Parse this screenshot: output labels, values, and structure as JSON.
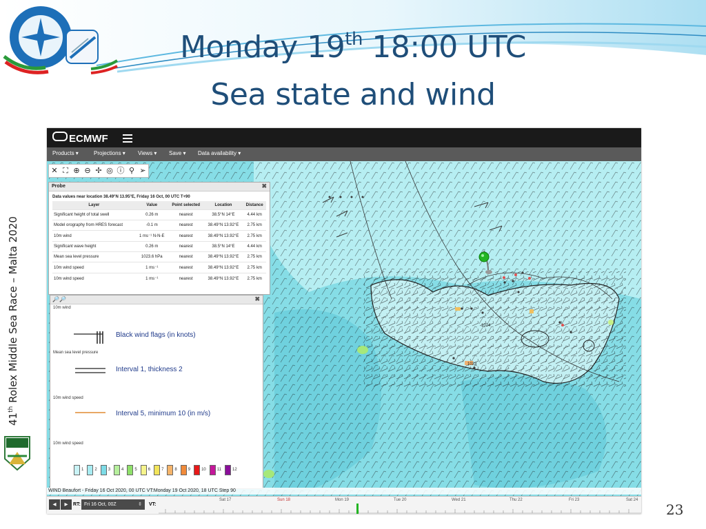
{
  "slide": {
    "title_line1_main": "Monday 19",
    "title_line1_sup": "th",
    "title_line1_tail": " 18:00 UTC",
    "title_line2": "Sea state and wind",
    "side_label_pre": "41",
    "side_label_sup": "th",
    "side_label_post": " Rolex Middle Sea Race – Malta 2020",
    "page_number": "23"
  },
  "app": {
    "brand": "ECMWF",
    "menu": [
      "Products ▾",
      "Projections ▾",
      "Views ▾",
      "Save ▾",
      "Data availability ▾"
    ],
    "toolbar_icons": [
      "close-icon",
      "fullscreen-icon",
      "zoom-in-icon",
      "zoom-out-icon",
      "pan-icon",
      "globe-icon",
      "info-icon",
      "location-pin-icon",
      "share-icon"
    ]
  },
  "probe": {
    "title": "Probe",
    "close": "✖",
    "info": "Data values near location 38.49°N 13.95°E, Friday 16 Oct, 00 UTC T+90",
    "headers": [
      "Layer",
      "Value",
      "Point selected",
      "Location",
      "Distance"
    ],
    "rows": [
      [
        "Significant height of total swell",
        "0.26 m",
        "nearest",
        "38.5°N 14°E",
        "4.44 km"
      ],
      [
        "Model orography from HRES forecast",
        "-0.1 m",
        "nearest",
        "38.49°N 13.92°E",
        "2.75 km"
      ],
      [
        "10m wind",
        "1 ms⁻¹ N-N-E",
        "nearest",
        "38.49°N 13.92°E",
        "2.75 km"
      ],
      [
        "Significant wave height",
        "0.26 m",
        "nearest",
        "38.5°N 14°E",
        "4.44 km"
      ],
      [
        "Mean sea level pressure",
        "1023.6 hPa",
        "nearest",
        "38.49°N 13.92°E",
        "2.75 km"
      ],
      [
        "10m wind speed",
        "1 ms⁻¹",
        "nearest",
        "38.49°N 13.92°E",
        "2.75 km"
      ],
      [
        "10m wind speed",
        "1 ms⁻¹",
        "nearest",
        "38.49°N 13.92°E",
        "2.75 km"
      ]
    ]
  },
  "legend": {
    "zoom_icons": "🔎🔎",
    "close": "✖",
    "sections": [
      {
        "name": "10m wind",
        "desc": "Black wind flags (in knots)"
      },
      {
        "name": "Mean sea level pressure",
        "desc": "Interval 1, thickness 2"
      },
      {
        "name": "10m wind speed",
        "desc": "Interval 5, minimum 10 (in m/s)"
      },
      {
        "name": "10m wind speed",
        "desc": ""
      }
    ],
    "scale_labels": [
      "1",
      "2",
      "3",
      "4",
      "5",
      "6",
      "7",
      "8",
      "9",
      "10",
      "11",
      "12"
    ],
    "scale_colors": [
      "#c9f3f6",
      "#a8ecf2",
      "#7ddbe6",
      "#b6ef9c",
      "#8fe06a",
      "#f6f48c",
      "#f2e45a",
      "#f5b46a",
      "#f08a3a",
      "#e81818",
      "#c4189a",
      "#8a0e9a"
    ]
  },
  "status": {
    "text": "WIND Beaufort - Friday 16 Oct 2020, 00 UTC VT:Monday 19 Oct 2020, 18 UTC Step 90"
  },
  "timebar": {
    "rt_label": "RT:",
    "rt_value": "Fri 16 Oct, 00Z",
    "vt_label": "VT:",
    "days": [
      "Sat 17",
      "Sun 18",
      "Mon 19",
      "Tue 20",
      "Wed 21",
      "Thu 22",
      "Fri 23",
      "Sat 24"
    ]
  }
}
